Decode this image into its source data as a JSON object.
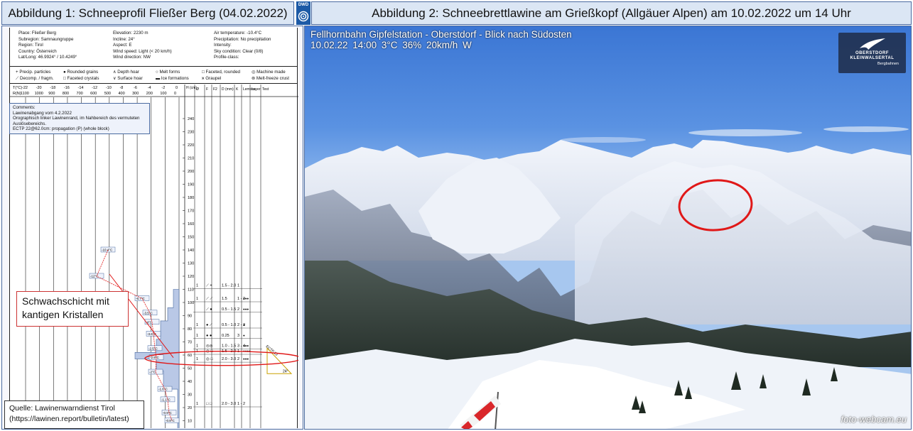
{
  "titles": {
    "left": "Abbildung 1: Schneeprofil Fließer Berg (04.02.2022)",
    "right": "Abbildung 2: Schneebrettlawine am Grießkopf (Allgäuer Alpen) am 10.02.2022 um 14 Uhr"
  },
  "dwd_logo": "DWD",
  "profile": {
    "meta": {
      "col1": [
        "Place: Fließer Berg",
        "Subregion: Samnaungruppe",
        "Region: Tirol",
        "Country: Österreich",
        "Lat/Long: 46.9924° / 10.4249°"
      ],
      "col2": [
        "Elevation: 2230 m",
        "Incline: 24°",
        "Aspect: E",
        "Wind speed: Light (< 20 km/h)",
        "Wind direction: NW"
      ],
      "col3": [
        "Air temperature: -10.4°C",
        "Precipitation: No precipitation",
        "Intensity:",
        "Sky condition: Clear (0/8)",
        "Profile-class:"
      ]
    },
    "legend": [
      "+ Precip. particles",
      "● Rounded grains",
      "∧ Depth hoar",
      "○ Melt forms",
      "□ Faceted, rounded",
      "◎ Machine made",
      "⟋ Decomp. / fragm.",
      "□ Faceted crystals",
      "∨ Surface hoar",
      "▬ Ice formations",
      "⩙ Graupel",
      "⊚ Melt-freeze crust"
    ],
    "temp_axis_label": "T(°C)",
    "temp_ticks": [
      "-22",
      "-20",
      "-18",
      "-16",
      "-14",
      "-12",
      "-10",
      "-8",
      "-6",
      "-4",
      "-2",
      "0"
    ],
    "res_axis_label": "R(N)",
    "res_ticks": [
      "1100",
      "1000",
      "900",
      "800",
      "700",
      "600",
      "500",
      "400",
      "300",
      "200",
      "100",
      "0"
    ],
    "height_axis_label": "H (cm)",
    "height_ticks": [
      "240",
      "230",
      "220",
      "210",
      "200",
      "190",
      "180",
      "170",
      "160",
      "150",
      "140",
      "130",
      "120",
      "110",
      "100",
      "90",
      "80",
      "70",
      "60",
      "50",
      "40",
      "30",
      "20",
      "10"
    ],
    "table_headers": [
      "Ø",
      "F",
      "F2",
      "D (mm)",
      "K",
      "Lemons",
      "Layer",
      "Test"
    ],
    "comments": [
      "Comments:",
      "Lawinenabgang vom 4.2.2022",
      "Orographisch linker Lawinenrand, im Nahbereich des vermuteten",
      "Auslösebereichs.",
      "ECTP 22@62.0cm: propagation (P) (whole block)"
    ],
    "temp_labels": [
      "-10.4°C",
      "-12°C",
      "-6.7°C",
      "-3.5°C",
      "-4°C",
      "-3.6°C",
      "-2.5°C",
      "-2.9°C",
      "-2°C",
      "-1.6°C",
      "-1.1°C",
      "-0.9°C",
      "-0.8°C"
    ],
    "layer_rows": [
      {
        "grain": "1",
        "form": "⟋ +",
        "size": "1.5 - 2.0",
        "hard": "1",
        "extra": ""
      },
      {
        "grain": "1",
        "form": "⟋ ⟋",
        "size": "1.5",
        "hard": "1 - 2",
        "extra": "●●●"
      },
      {
        "grain": "",
        "form": "⟋ ●",
        "size": "0.5 - 1.5",
        "hard": "2",
        "extra": "●●●"
      },
      {
        "grain": "1",
        "form": "● ⟋",
        "size": "0.5 - 1.0",
        "hard": "2 - 3",
        "extra": "●"
      },
      {
        "grain": "1",
        "form": "● ●",
        "size": "0.25",
        "hard": "3",
        "extra": "●"
      },
      {
        "grain": "1",
        "form": "◎◎",
        "size": "1.0 - 1.5",
        "hard": "3 - 4",
        "extra": "●●●"
      },
      {
        "grain": "1",
        "form": "◎ □",
        "size": "1.5 - 2.0",
        "hard": "1",
        "extra": "●●●●"
      },
      {
        "grain": "1",
        "form": "◎ □",
        "size": "2.0 - 3.0",
        "hard": "2",
        "extra": "●●●"
      },
      {
        "grain": "1",
        "form": "□ □",
        "size": "2.0 - 3.0",
        "hard": "1 - 2",
        "extra": ""
      }
    ],
    "ect_label": "ECTP 22",
    "angle_label": "24°",
    "weak_layer_note": "Schwachschicht mit kantigen Kristallen",
    "source_line1": "Quelle: Lawinenwarndienst Tirol",
    "source_line2": "(https://lawinen.report/bulletin/latest)"
  },
  "photo": {
    "camera_line1": "Fellhornbahn Gipfelstation - Oberstdorf - Blick nach Südosten",
    "camera_line2": "10.02.22 14:00   3°C   36%   20km/h W",
    "brand_line1": "OBERSTDORF",
    "brand_line2": "KLEINWALSERTAL",
    "brand_line3": "Bergbahnen",
    "watermark": "foto-webcam.eu"
  },
  "colors": {
    "title_bg": "#dbe6f4",
    "frame": "#4a6aa0",
    "marker_red": "#e01818",
    "profile_fill": "#b9c8e6"
  }
}
